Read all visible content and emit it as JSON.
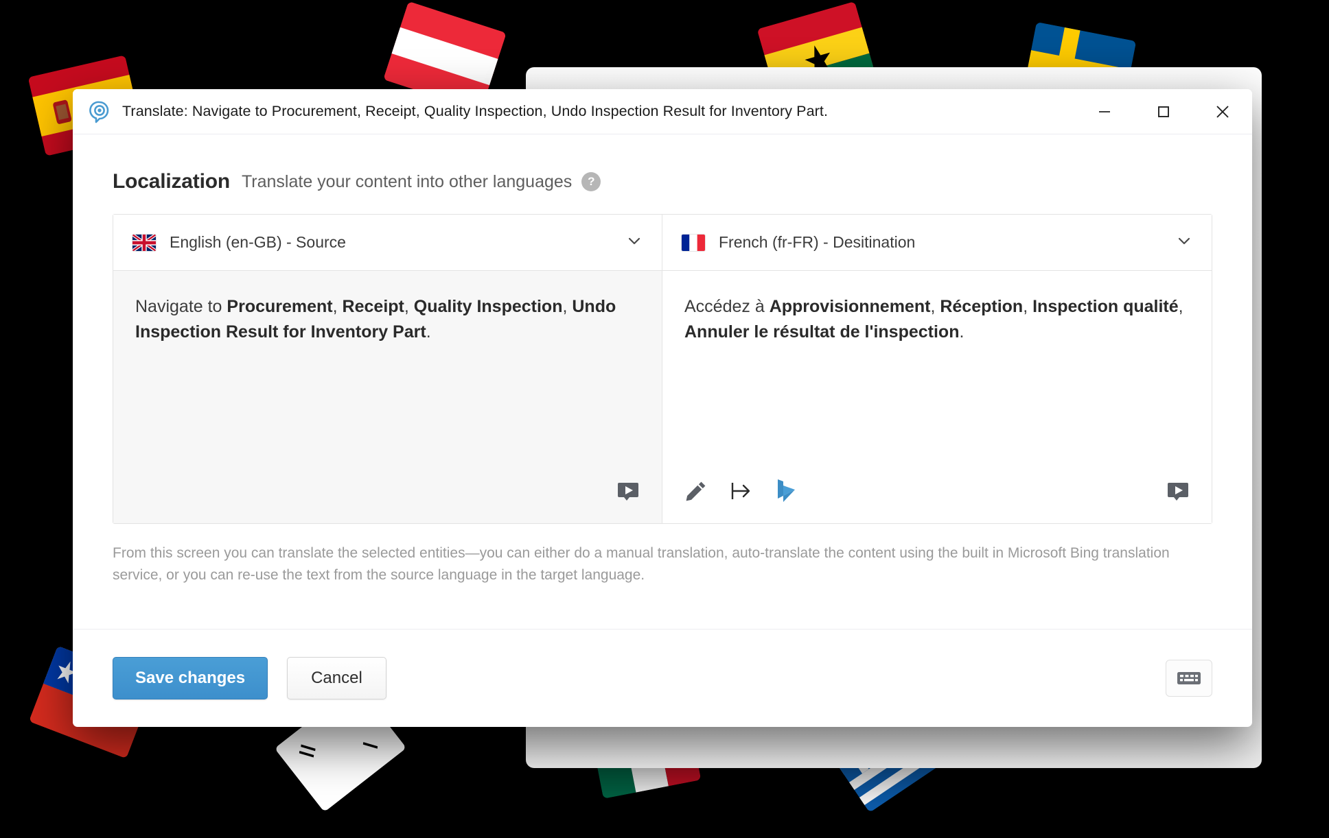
{
  "window": {
    "title": "Translate: Navigate to Procurement, Receipt, Quality Inspection, Undo Inspection Result for Inventory Part.",
    "title_icon": "location-target-icon",
    "controls": {
      "minimize": "minimize-icon",
      "maximize": "maximize-icon",
      "close": "close-icon"
    }
  },
  "header": {
    "title": "Localization",
    "subtitle": "Translate your content into other languages",
    "help_badge": "?"
  },
  "panels": {
    "source": {
      "flag": "gb-flag",
      "language_label": "English (en-GB) - Source",
      "dropdown_icon": "chevron-down-icon",
      "text_segments": [
        {
          "text": "Navigate to ",
          "bold": false
        },
        {
          "text": "Procurement",
          "bold": true
        },
        {
          "text": ", ",
          "bold": false
        },
        {
          "text": "Receipt",
          "bold": true
        },
        {
          "text": ", ",
          "bold": false
        },
        {
          "text": "Quality Inspection",
          "bold": true
        },
        {
          "text": ", ",
          "bold": false
        },
        {
          "text": "Undo Inspection Result for Inventory Part",
          "bold": true
        },
        {
          "text": ".",
          "bold": false
        }
      ],
      "actions": [
        {
          "name": "speak-source-icon",
          "label": "Speak"
        }
      ]
    },
    "destination": {
      "flag": "fr-flag",
      "language_label": "French (fr-FR) - Desitination",
      "dropdown_icon": "chevron-down-icon",
      "text_segments": [
        {
          "text": "Accédez à ",
          "bold": false
        },
        {
          "text": "Approvisionnement",
          "bold": true
        },
        {
          "text": ", ",
          "bold": false
        },
        {
          "text": "Réception",
          "bold": true
        },
        {
          "text": ", ",
          "bold": false
        },
        {
          "text": "Inspection qualité",
          "bold": true
        },
        {
          "text": ", ",
          "bold": false
        },
        {
          "text": "Annuler le résultat de l'inspection",
          "bold": true
        },
        {
          "text": ".",
          "bold": false
        }
      ],
      "actions": [
        {
          "name": "edit-pencil-icon",
          "label": "Edit"
        },
        {
          "name": "copy-source-arrow-icon",
          "label": "Re-use source text"
        },
        {
          "name": "bing-translate-icon",
          "label": "Bing translate"
        },
        {
          "name": "speak-destination-icon",
          "label": "Speak"
        }
      ]
    }
  },
  "description": "From this screen you can translate the selected entities—you can either do a manual translation, auto-translate the content using the built in Microsoft Bing translation service, or you can re-use the text from the source language in the target language.",
  "footer": {
    "save_label": "Save changes",
    "cancel_label": "Cancel",
    "keyboard_icon": "keyboard-icon"
  },
  "colors": {
    "accent_blue": "#3d8fcc",
    "bing_blue": "#3c8dc5",
    "title_icon_blue": "#4a9bd1",
    "icon_gray": "#5b5f66",
    "help_gray": "#b6b6b6",
    "description_gray": "#9a9a9a",
    "backdrop": "#000000"
  },
  "background": {
    "decorative_flags": [
      "spain-flag",
      "austria-flag",
      "ghana-flag",
      "sweden-flag",
      "chile-flag",
      "south-korea-flag",
      "mexico-flag",
      "greece-flag"
    ]
  }
}
